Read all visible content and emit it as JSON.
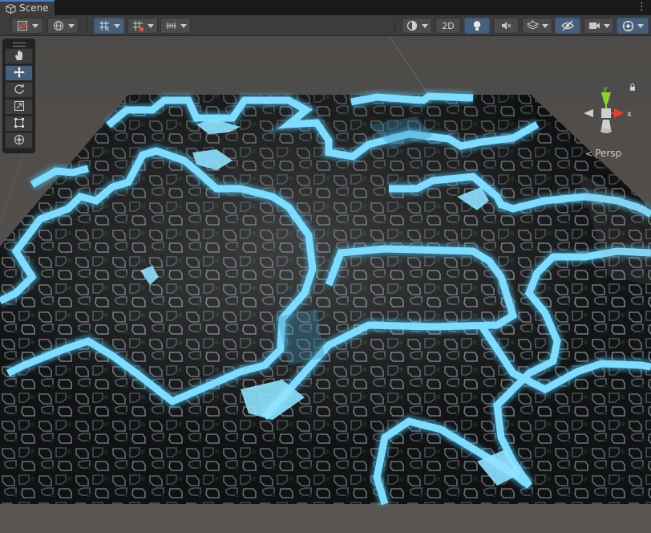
{
  "window": {
    "tab_label": "Scene",
    "tab_icon": "scene-icon",
    "menu_icon": "kebab-menu-icon"
  },
  "toolbar": {
    "left_buttons": [
      {
        "icon": "draw-mode-icon",
        "has_dropdown": true
      },
      {
        "icon": "global-local-icon",
        "has_dropdown": true
      },
      {
        "icon": "grid-snap-icon",
        "has_dropdown": true,
        "active": true
      },
      {
        "icon": "increment-snap-icon",
        "has_dropdown": true
      },
      {
        "icon": "snap-settings-icon",
        "has_dropdown": true
      }
    ],
    "right_buttons": [
      {
        "icon": "shading-mode-icon",
        "has_dropdown": true
      },
      {
        "label": "2D"
      },
      {
        "icon": "lighting-icon",
        "active": true
      },
      {
        "icon": "audio-mute-icon"
      },
      {
        "icon": "effects-icon",
        "has_dropdown": true
      },
      {
        "icon": "visibility-icon",
        "active": true
      },
      {
        "icon": "camera-icon",
        "has_dropdown": true
      },
      {
        "icon": "gizmos-icon",
        "has_dropdown": true,
        "active": true
      }
    ]
  },
  "tools_overlay": {
    "items": [
      {
        "name": "hand-tool",
        "icon": "hand-icon"
      },
      {
        "name": "move-tool",
        "icon": "move-icon",
        "active": true
      },
      {
        "name": "rotate-tool",
        "icon": "rotate-icon"
      },
      {
        "name": "scale-tool",
        "icon": "scale-icon"
      },
      {
        "name": "rect-tool",
        "icon": "rect-icon"
      },
      {
        "name": "transform-tool",
        "icon": "transform-icon"
      }
    ]
  },
  "gizmo": {
    "x_label": "x",
    "y_label": "y",
    "lock_icon": "lock-icon"
  },
  "projection": {
    "label": "Persp",
    "icon": "perspective-icon"
  },
  "colors": {
    "accent": "#4b7bd0",
    "active_button": "#46607c",
    "glow": "#6fd8ff",
    "x_axis": "#e2412e",
    "y_axis": "#8cd22c"
  }
}
